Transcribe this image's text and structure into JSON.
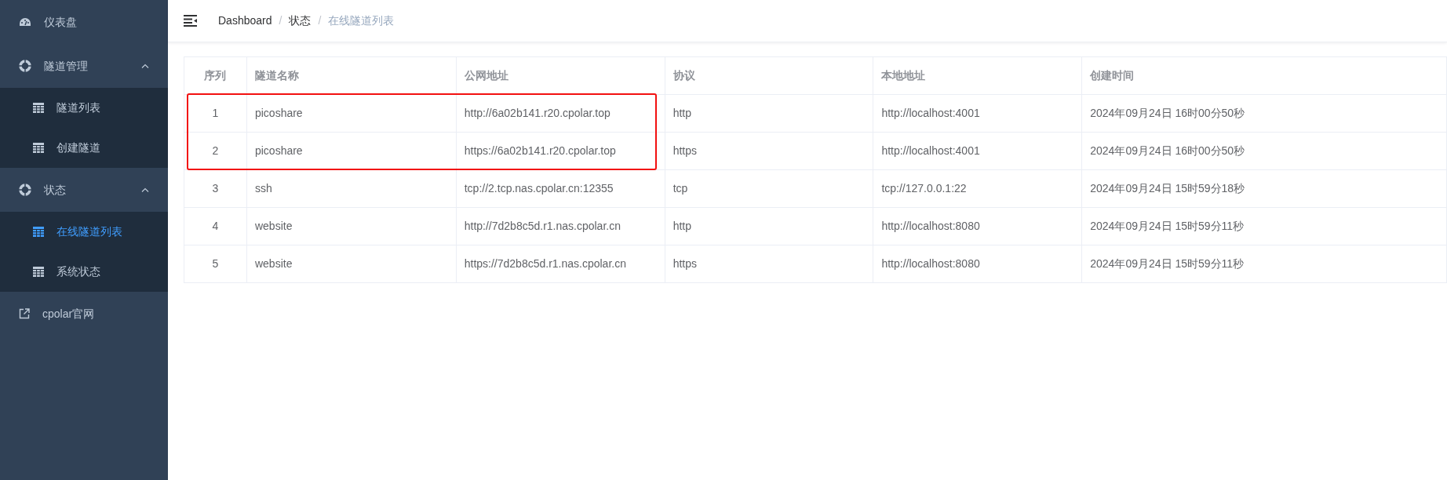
{
  "sidebar": {
    "items": [
      {
        "label": "仪表盘",
        "kind": "gauge",
        "selected": false
      },
      {
        "label": "隧道管理",
        "kind": "lifebuoy",
        "expanded": true,
        "children": [
          {
            "label": "隧道列表",
            "kind": "table",
            "selected": false
          },
          {
            "label": "创建隧道",
            "kind": "table",
            "selected": false
          }
        ]
      },
      {
        "label": "状态",
        "kind": "lifebuoy",
        "expanded": true,
        "children": [
          {
            "label": "在线隧道列表",
            "kind": "table",
            "selected": true
          },
          {
            "label": "系统状态",
            "kind": "table",
            "selected": false
          }
        ]
      },
      {
        "label": "cpolar官网",
        "kind": "external",
        "selected": false
      }
    ]
  },
  "breadcrumb": [
    {
      "kind": "link",
      "text": "Dashboard"
    },
    {
      "kind": "separator",
      "text": "/"
    },
    {
      "kind": "link",
      "text": "状态"
    },
    {
      "kind": "separator",
      "text": "/"
    },
    {
      "kind": "current",
      "text": "在线隧道列表"
    }
  ],
  "table": {
    "columns": [
      "序列",
      "隧道名称",
      "公网地址",
      "协议",
      "本地地址",
      "创建时间"
    ],
    "rows": [
      {
        "highlighted": true,
        "cells": [
          "1",
          "picoshare",
          "http://6a02b141.r20.cpolar.top",
          "http",
          "http://localhost:4001",
          "2024年09月24日 16时00分50秒"
        ]
      },
      {
        "highlighted": true,
        "cells": [
          "2",
          "picoshare",
          "https://6a02b141.r20.cpolar.top",
          "https",
          "http://localhost:4001",
          "2024年09月24日 16时00分50秒"
        ]
      },
      {
        "highlighted": false,
        "cells": [
          "3",
          "ssh",
          "tcp://2.tcp.nas.cpolar.cn:12355",
          "tcp",
          "tcp://127.0.0.1:22",
          "2024年09月24日 15时59分18秒"
        ]
      },
      {
        "highlighted": false,
        "cells": [
          "4",
          "website",
          "http://7d2b8c5d.r1.nas.cpolar.cn",
          "http",
          "http://localhost:8080",
          "2024年09月24日 15时59分11秒"
        ]
      },
      {
        "highlighted": false,
        "cells": [
          "5",
          "website",
          "https://7d2b8c5d.r1.nas.cpolar.cn",
          "https",
          "http://localhost:8080",
          "2024年09月24日 15时59分11秒"
        ]
      }
    ]
  }
}
